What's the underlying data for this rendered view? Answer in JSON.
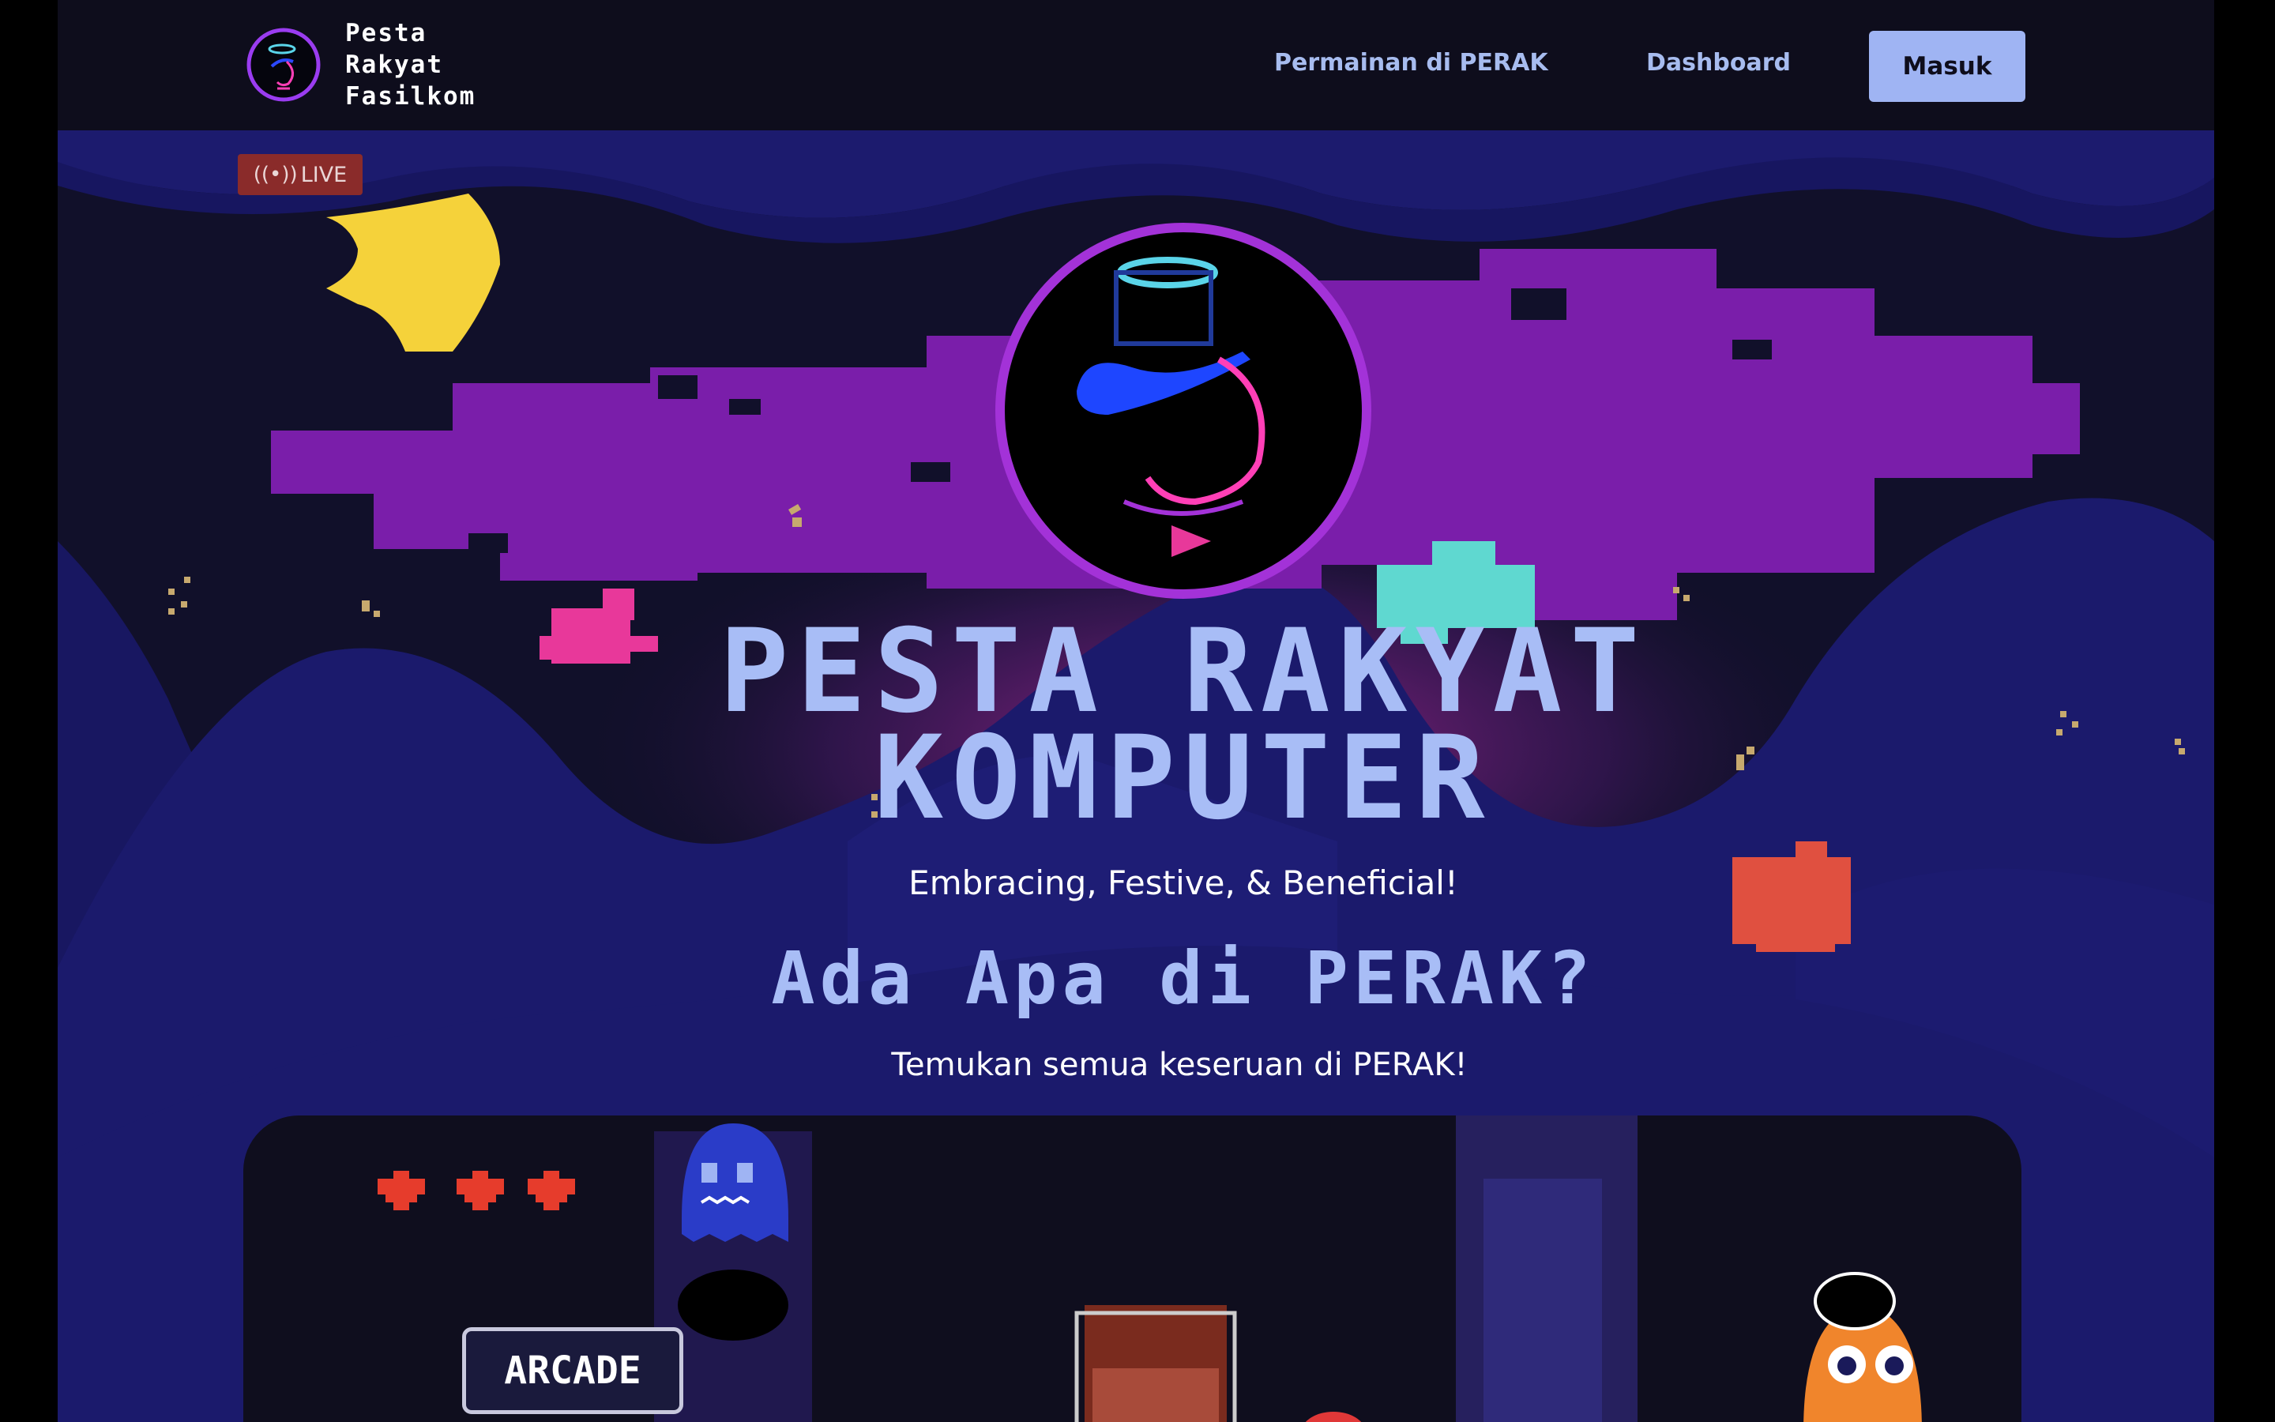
{
  "nav": {
    "brand_lines": [
      "Pesta",
      "Rakyat",
      "Fasilkom"
    ],
    "links": [
      "Permainan di PERAK",
      "Dashboard"
    ],
    "login_label": "Masuk"
  },
  "hero": {
    "live_label": "LIVE",
    "title_line1": "PESTA RAKYAT",
    "title_line2": "KOMPUTER",
    "tagline": "Embracing, Festive, & Beneficial!",
    "section_title": "Ada Apa di PERAK?",
    "section_subtitle": "Temukan semua keseruan di PERAK!"
  },
  "card": {
    "lives": 3,
    "arcade_label": "ARCADE"
  },
  "colors": {
    "accent": "#9fb4f3",
    "title": "#a8bdf6",
    "live_bg": "#8a2b2a",
    "purple_cloud": "#7a1eaa",
    "heart": "#e63c2c"
  }
}
